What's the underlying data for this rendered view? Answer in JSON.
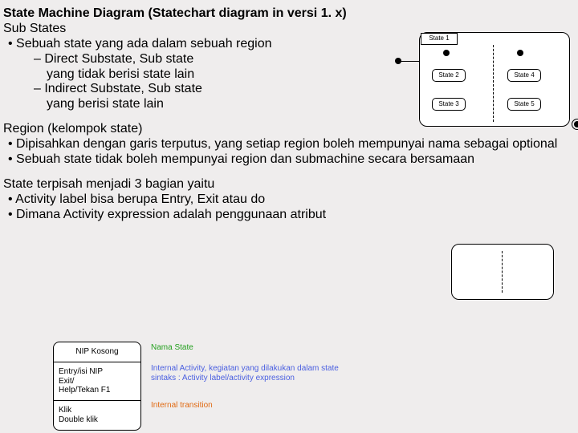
{
  "title": "State Machine Diagram (Statechart diagram in versi 1. x)",
  "subStates": {
    "heading": "Sub States",
    "b1": "Sebuah state yang ada dalam sebuah region",
    "b2a": "Direct Substate, Sub state",
    "b2a2": "yang tidak berisi state lain",
    "b2b": "Indirect Substate, Sub state",
    "b2b2": "yang berisi state lain"
  },
  "region": {
    "heading": "Region (kelompok state)",
    "b1": "Dipisahkan dengan garis terputus, yang setiap region boleh mempunyai nama sebagai optional",
    "b2": "Sebuah state tidak boleh mempunyai region dan submachine secara bersamaan"
  },
  "stateParts": {
    "heading": "State terpisah menjadi 3 bagian yaitu",
    "b1": "Activity label bisa berupa Entry, Exit atau do",
    "b2": "Dimana Activity expression adalah penggunaan atribut"
  },
  "sd": {
    "tab": "State 1",
    "s2": "State 2",
    "s3": "State 3",
    "s4": "State 4",
    "s5": "State 5"
  },
  "comp": {
    "r1": "NIP Kosong",
    "r2": "Entry/isi NIP\nExit/\nHelp/Tekan F1",
    "r3": "Klik\nDouble klik"
  },
  "labels": {
    "nama": "Nama State",
    "internalAct1": "Internal Activity, kegiatan yang dilakukan dalam state",
    "internalAct2": "sintaks : Activity label/activity expression",
    "internalTrans": "Internal transition"
  }
}
